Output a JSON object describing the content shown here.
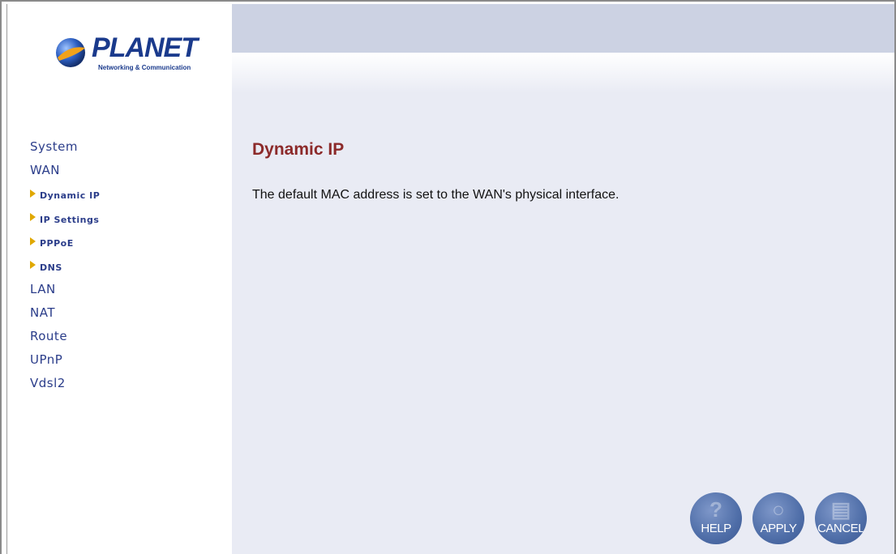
{
  "brand": {
    "name": "PLANET",
    "tagline": "Networking & Communication"
  },
  "nav": {
    "items": [
      {
        "label": "System"
      },
      {
        "label": "WAN"
      },
      {
        "label": "LAN"
      },
      {
        "label": "NAT"
      },
      {
        "label": "Route"
      },
      {
        "label": "UPnP"
      },
      {
        "label": "Vdsl2"
      }
    ],
    "wan_subitems": [
      {
        "label": "Dynamic IP"
      },
      {
        "label": "IP Settings"
      },
      {
        "label": "PPPoE"
      },
      {
        "label": "DNS"
      }
    ]
  },
  "main": {
    "title": "Dynamic IP",
    "description": "The default MAC address is set to the WAN's physical interface."
  },
  "buttons": {
    "help": "HELP",
    "apply": "APPLY",
    "cancel": "CANCEL"
  },
  "colors": {
    "nav_text": "#2b3d8a",
    "title": "#8c2a2a",
    "arrow": "#e0a800",
    "content_bg": "#e9ebf4",
    "topbar": "#ccd2e3"
  }
}
